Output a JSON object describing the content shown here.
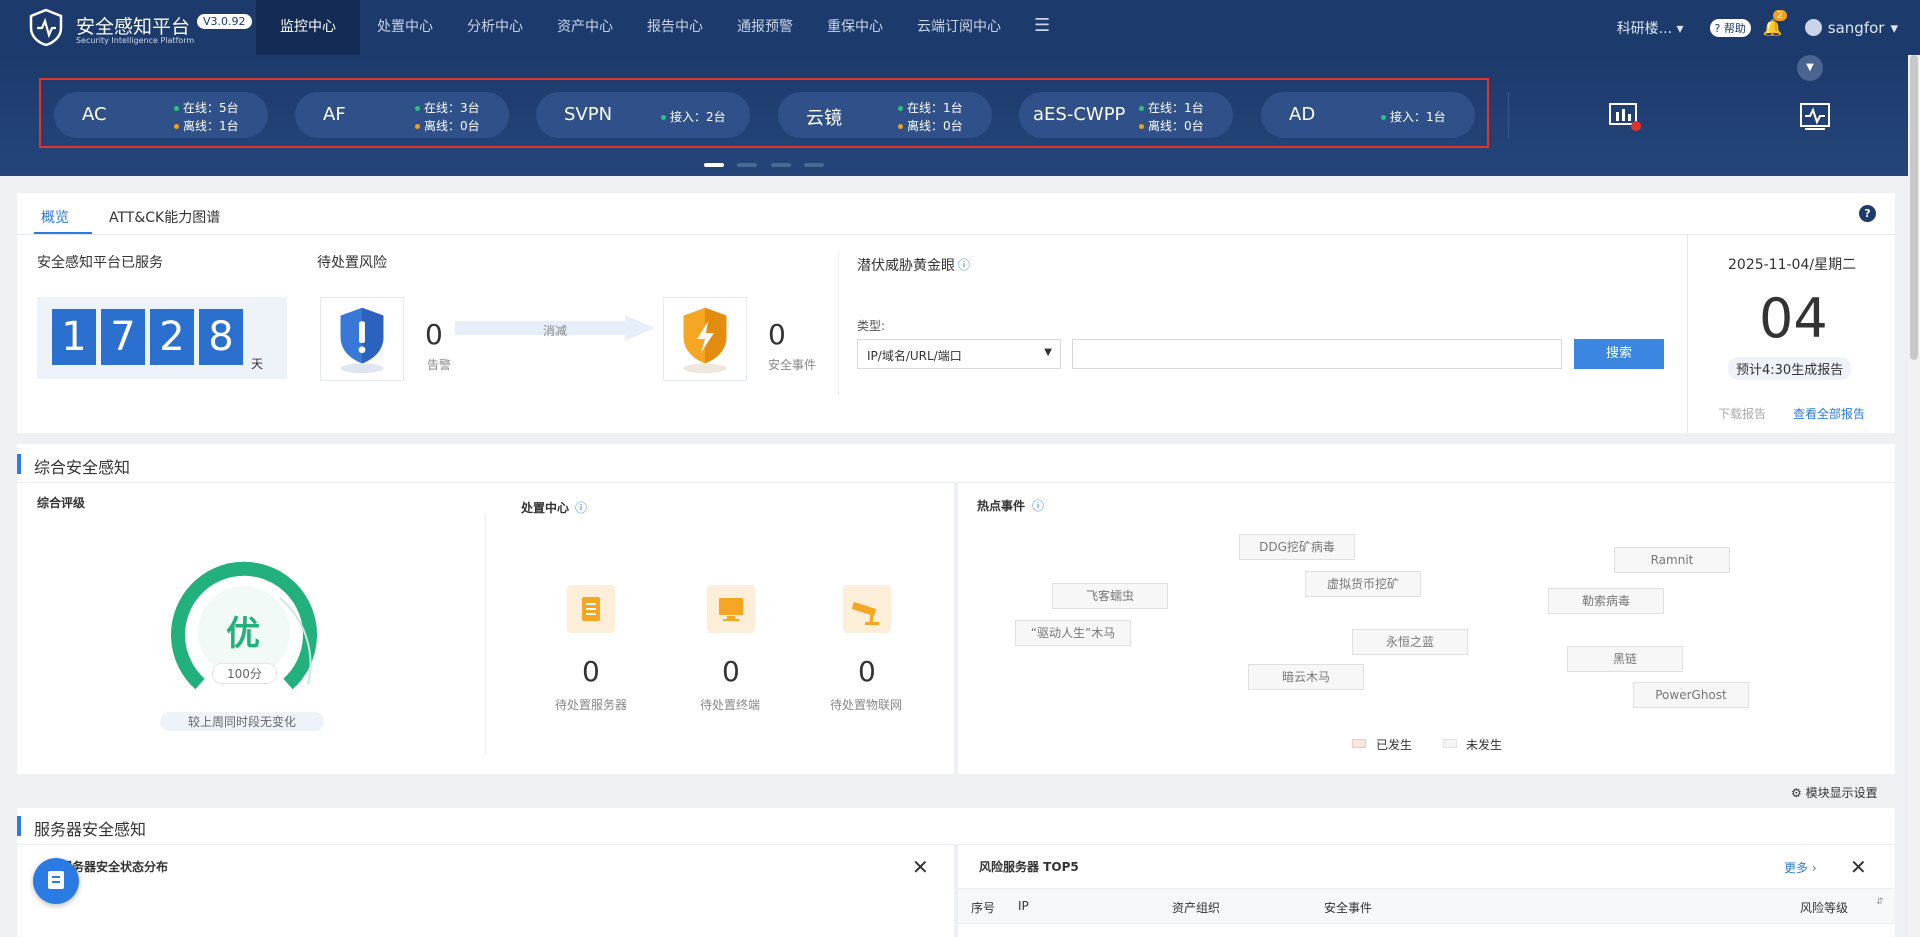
{
  "app": {
    "title": "安全感知平台",
    "subtitle": "Security Intelligence Platform",
    "version": "V3.0.92"
  },
  "nav": {
    "items": [
      "监控中心",
      "处置中心",
      "分析中心",
      "资产中心",
      "报告中心",
      "通报预警",
      "重保中心",
      "云端订阅中心"
    ],
    "active": "监控中心"
  },
  "header_right": {
    "org": "科研楼...",
    "help": "帮助",
    "notif_count": "2",
    "user": "sangfor"
  },
  "devices": [
    {
      "name": "AC",
      "line1": "在线：5台",
      "line2": "离线：1台"
    },
    {
      "name": "AF",
      "line1": "在线：3台",
      "line2": "离线：0台"
    },
    {
      "name": "SVPN",
      "line1": "接入：2台",
      "line2": ""
    },
    {
      "name": "云镜",
      "line1": "在线：1台",
      "line2": "离线：0台"
    },
    {
      "name": "aES-CWPP",
      "line1": "在线：1台",
      "line2": "离线：0台"
    },
    {
      "name": "AD",
      "line1": "接入：1台",
      "line2": ""
    }
  ],
  "tabs": [
    "概览",
    "ATT&CK能力图谱"
  ],
  "service": {
    "title": "安全感知平台已服务",
    "digits": [
      "1",
      "7",
      "2",
      "8"
    ],
    "unit": "天"
  },
  "risk": {
    "title": "待处置风险",
    "alerts_value": "0",
    "alerts_label": "告警",
    "arrow_label": "消减",
    "events_value": "0",
    "events_label": "安全事件"
  },
  "golden_eye": {
    "title": "潜伏威胁黄金眼",
    "type_label": "类型:",
    "type_value": "IP/域名/URL/端口",
    "search_btn": "搜索"
  },
  "report": {
    "date": "2025-11-04/星期二",
    "day": "04",
    "note": "预计4:30生成报告",
    "download": "下载报告",
    "view_all": "查看全部报告"
  },
  "overview": {
    "title": "综合安全感知",
    "rating_title": "综合评级",
    "grade": "优",
    "score": "100分",
    "compare": "较上周同时段无变化",
    "disposal_title": "处置中心",
    "disposal": [
      {
        "value": "0",
        "label": "待处置服务器"
      },
      {
        "value": "0",
        "label": "待处置终端"
      },
      {
        "value": "0",
        "label": "待处置物联网"
      }
    ],
    "hot_title": "热点事件",
    "hot_tags": [
      "DDG挖矿病毒",
      "Ramnit",
      "飞客蠕虫",
      "虚拟货币挖矿",
      "勒索病毒",
      "“驱动人生”木马",
      "永恒之蓝",
      "黑链",
      "暗云木马",
      "PowerGhost"
    ],
    "legend_occurred": "已发生",
    "legend_not": "未发生",
    "module_settings": "模块显示设置"
  },
  "server": {
    "title": "服务器安全感知",
    "dist_title": "服务器安全状态分布",
    "top5_title": "风险服务器 TOP5",
    "more": "更多",
    "columns": [
      "序号",
      "IP",
      "资产组织",
      "安全事件",
      "风险等级"
    ]
  },
  "colors": {
    "nav_bg": "#1c3a6b",
    "accent": "#2b7be4",
    "online": "#2ec27e",
    "offline": "#f0a020",
    "grade": "#22b07d"
  }
}
